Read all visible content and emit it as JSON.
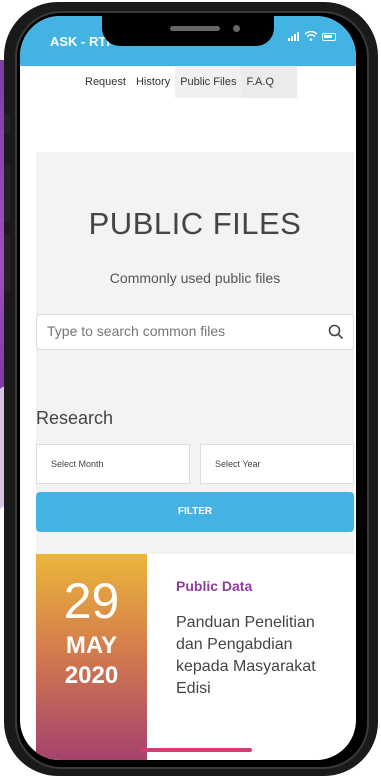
{
  "app": {
    "title": "ASK - RTI"
  },
  "tabs": [
    {
      "label": "Request"
    },
    {
      "label": "History"
    },
    {
      "label": "Public Files"
    },
    {
      "label": "F.A.Q"
    }
  ],
  "page": {
    "title": "PUBLIC FILES",
    "subtitle": "Commonly used public files"
  },
  "search": {
    "placeholder": "Type to search common files"
  },
  "section": {
    "title": "Research"
  },
  "filters": {
    "month_placeholder": "Select Month",
    "year_placeholder": "Select Year",
    "button_label": "FILTER"
  },
  "files": [
    {
      "day": "29",
      "month": "MAY",
      "year": "2020",
      "category": "Public Data",
      "title": "Panduan Penelitian dan Pengabdian kepada Masyarakat Edisi"
    }
  ],
  "colors": {
    "accent": "#43b3e4",
    "category": "#8b3f9a",
    "indicator": "#d63a71"
  }
}
